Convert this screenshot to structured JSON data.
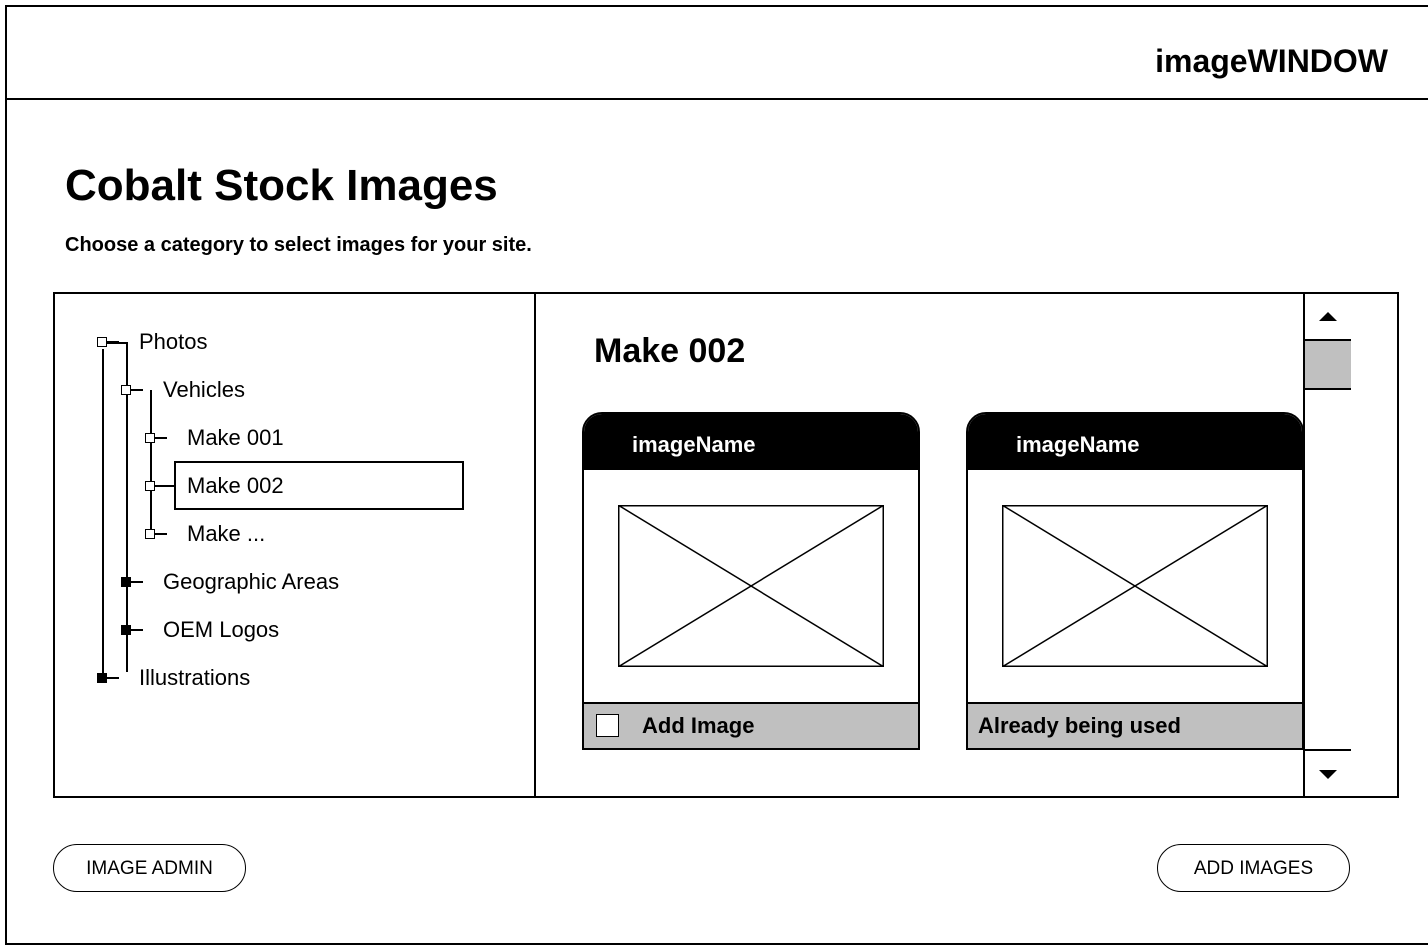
{
  "app": {
    "title": "imageWINDOW"
  },
  "page": {
    "title": "Cobalt Stock Images",
    "subtitle": "Choose a category to select images for your site."
  },
  "tree": {
    "photos": "Photos",
    "vehicles": "Vehicles",
    "make001": "Make 001",
    "make002": "Make 002",
    "make_more": "Make ...",
    "geographic": "Geographic Areas",
    "oem": "OEM Logos",
    "illustrations": "Illustrations",
    "selected": "Make 002"
  },
  "content": {
    "title": "Make 002",
    "cards": [
      {
        "name": "imageName",
        "footer": "Add Image",
        "has_checkbox": true
      },
      {
        "name": "imageName",
        "footer": "Already being used",
        "has_checkbox": false
      }
    ]
  },
  "buttons": {
    "image_admin": "IMAGE ADMIN",
    "add_images": "ADD IMAGES"
  },
  "colors": {
    "border": "#000000",
    "footer_bg": "#c0c0c0",
    "header_bg": "#000000"
  }
}
